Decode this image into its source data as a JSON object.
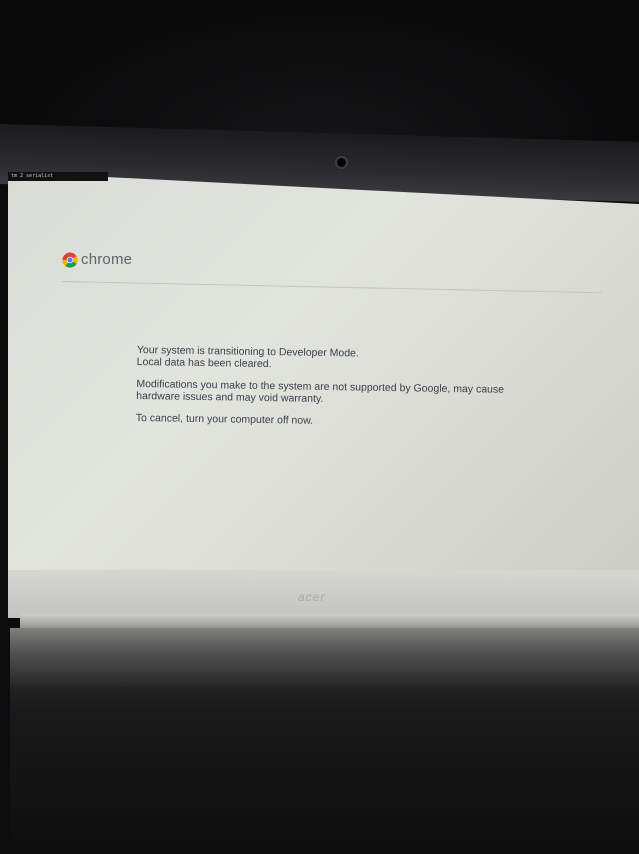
{
  "console": {
    "text": "tm 2 serialist"
  },
  "header": {
    "logo_text": "chrome",
    "logo_icon": "chrome-logo-icon"
  },
  "message": {
    "line1": "Your system is transitioning to Developer Mode.",
    "line2": "Local data has been cleared.",
    "line3": "Modifications you make to the system are not supported by Google, may cause",
    "line4": "hardware issues and may void warranty.",
    "line5": "To cancel, turn your computer off now."
  },
  "device": {
    "brand": "acer"
  },
  "colors": {
    "screen_bg": "#dfe1dc",
    "text": "#3c3f4a",
    "logo_text": "#5f6468"
  }
}
